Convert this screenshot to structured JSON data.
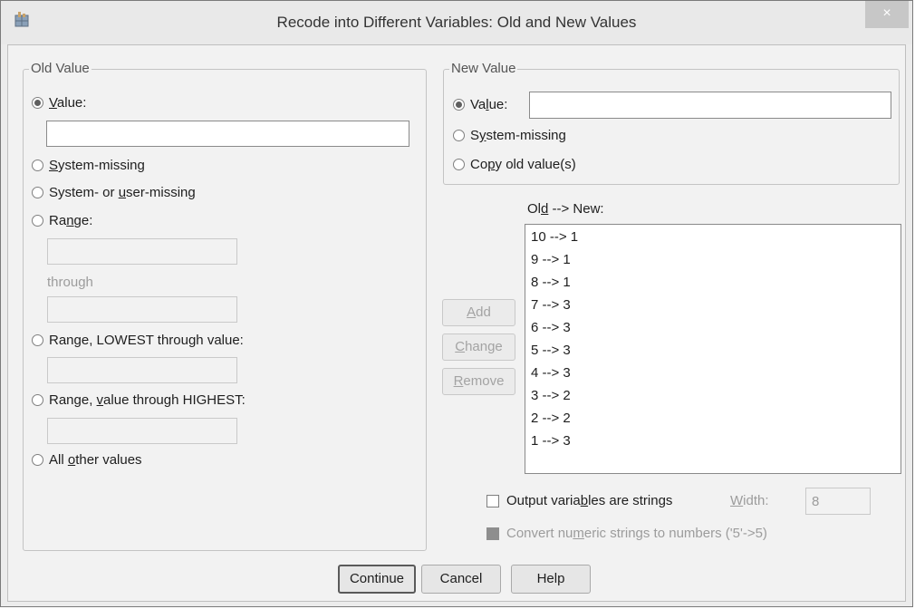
{
  "window": {
    "title": "Recode into Different Variables: Old and New Values",
    "close_glyph": "×"
  },
  "old_value": {
    "legend": "Old Value",
    "value": {
      "pre": "",
      "ul": "V",
      "post": "alue:"
    },
    "value_input": "",
    "system_missing": {
      "pre": "",
      "ul": "S",
      "post": "ystem-missing"
    },
    "system_or_user_missing": {
      "pre": "System- or ",
      "ul": "u",
      "post": "ser-missing"
    },
    "range": {
      "pre": "Ra",
      "ul": "n",
      "post": "ge:"
    },
    "through_label": "through",
    "range_lowest": {
      "pre": "Range, LOWEST through value:",
      "ul": "",
      "post": ""
    },
    "range_highest": {
      "pre": "Range, ",
      "ul": "v",
      "post": "alue through HIGHEST:"
    },
    "all_other": {
      "pre": "All ",
      "ul": "o",
      "post": "ther values"
    }
  },
  "new_value": {
    "legend": "New Value",
    "value": {
      "pre": "Va",
      "ul": "l",
      "post": "ue:"
    },
    "value_input": "",
    "system_missing": {
      "pre": "S",
      "ul": "y",
      "post": "stem-missing"
    },
    "copy_old": {
      "pre": "Co",
      "ul": "p",
      "post": "y old value(s)"
    }
  },
  "mapping": {
    "header": {
      "pre": "Ol",
      "ul": "d",
      "post": " --> New:"
    },
    "items": [
      "10 --> 1",
      "9 --> 1",
      "8 --> 1",
      "7 --> 3",
      "6 --> 3",
      "5 --> 3",
      "4 --> 3",
      "3 --> 2",
      "2 --> 2",
      "1 --> 3"
    ],
    "add": {
      "pre": "",
      "ul": "A",
      "post": "dd"
    },
    "change": {
      "pre": "",
      "ul": "C",
      "post": "hange"
    },
    "remove": {
      "pre": "",
      "ul": "R",
      "post": "emove"
    }
  },
  "options": {
    "output_strings": {
      "pre": "Output varia",
      "ul": "b",
      "post": "les are strings"
    },
    "width_label": {
      "pre": "",
      "ul": "W",
      "post": "idth:"
    },
    "width_value": "8",
    "convert_numeric": {
      "pre": "Convert nu",
      "ul": "m",
      "post": "eric strings to numbers ('5'->5)"
    }
  },
  "buttons": {
    "continue": "Continue",
    "cancel": "Cancel",
    "help": "Help"
  }
}
